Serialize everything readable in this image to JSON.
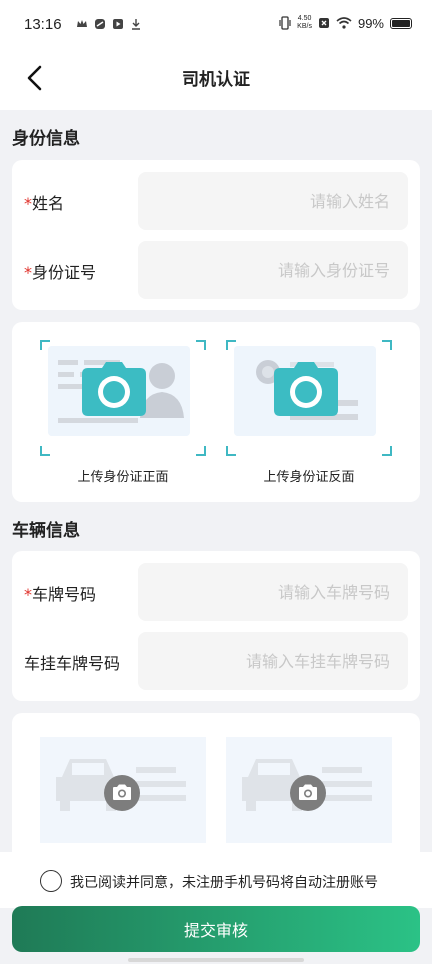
{
  "status_bar": {
    "time": "13:16",
    "net_speed_value": "4.50",
    "net_speed_unit": "KB/s",
    "battery": "99%"
  },
  "header": {
    "title": "司机认证"
  },
  "identity_section": {
    "title": "身份信息",
    "fields": [
      {
        "required_mark": "*",
        "label": "姓名",
        "placeholder": "请输入姓名",
        "value": ""
      },
      {
        "required_mark": "*",
        "label": "身份证号",
        "placeholder": "请输入身份证号",
        "value": ""
      }
    ],
    "uploads": [
      {
        "label": "上传身份证正面",
        "icon": "camera-icon"
      },
      {
        "label": "上传身份证反面",
        "icon": "camera-icon"
      }
    ]
  },
  "vehicle_section": {
    "title": "车辆信息",
    "fields": [
      {
        "required_mark": "*",
        "label": "车牌号码",
        "placeholder": "请输入车牌号码",
        "value": ""
      },
      {
        "required_mark": "",
        "label": "车挂车牌号码",
        "placeholder": "请输入车挂车牌号码",
        "value": ""
      }
    ],
    "uploads": [
      {
        "icon": "camera-icon"
      },
      {
        "icon": "camera-icon"
      }
    ]
  },
  "agreement": {
    "text": "我已阅读并同意，未注册手机号码将自动注册账号",
    "checked": false
  },
  "submit": {
    "label": "提交审核"
  },
  "colors": {
    "accent_teal": "#3fb8c3",
    "button_gradient_start": "#1f7a56",
    "button_gradient_end": "#2bc286",
    "required": "#e0322b"
  }
}
